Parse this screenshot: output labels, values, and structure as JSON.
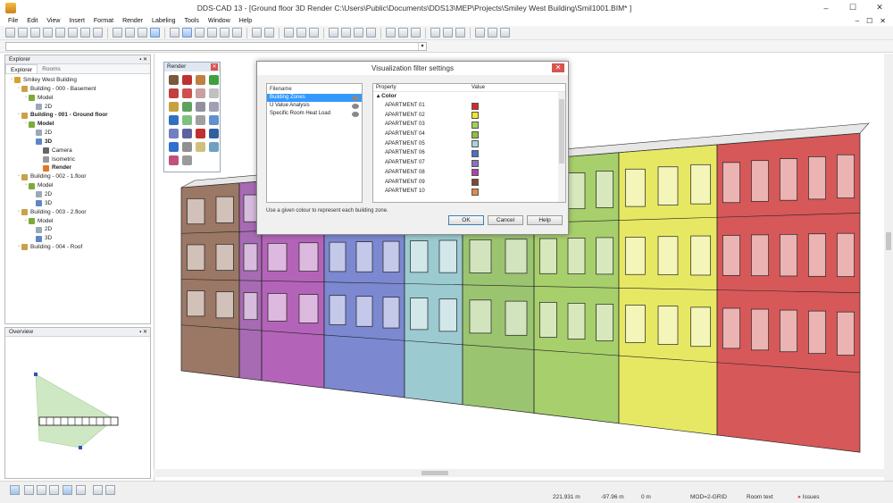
{
  "window": {
    "title": "DDS-CAD 13 - [Ground floor  3D  Render  C:\\Users\\Public\\Documents\\DDS13\\MEP\\Projects\\Smiley West Building\\Smil1001.BIM* ]",
    "minimize": "–",
    "maximize": "☐",
    "close": "✕"
  },
  "menu": [
    "File",
    "Edit",
    "View",
    "Insert",
    "Format",
    "Render",
    "Labeling",
    "Tools",
    "Window",
    "Help"
  ],
  "mdi_controls": [
    "–",
    "☐",
    "✕"
  ],
  "explorer": {
    "title": "Explorer",
    "pin": "▪ ✕",
    "tabs": [
      "Explorer",
      "Rooms"
    ],
    "tree": [
      {
        "label": "Smiley West Building",
        "level": 0,
        "icon": "project-icon",
        "bold": false
      },
      {
        "label": "Building - 000 - Basement",
        "level": 1,
        "icon": "building-icon",
        "bold": false
      },
      {
        "label": "Model",
        "level": 2,
        "icon": "model-icon",
        "bold": false
      },
      {
        "label": "2D",
        "level": 3,
        "icon": "2d-icon",
        "bold": false
      },
      {
        "label": "Building - 001 - Ground floor",
        "level": 1,
        "icon": "building-icon",
        "bold": true
      },
      {
        "label": "Model",
        "level": 2,
        "icon": "model-icon",
        "bold": true
      },
      {
        "label": "2D",
        "level": 3,
        "icon": "2d-icon",
        "bold": false
      },
      {
        "label": "3D",
        "level": 3,
        "icon": "3d-icon",
        "bold": true
      },
      {
        "label": "Camera",
        "level": 4,
        "icon": "camera-icon",
        "bold": false
      },
      {
        "label": "Isometric",
        "level": 4,
        "icon": "isometric-icon",
        "bold": false
      },
      {
        "label": "Render",
        "level": 4,
        "icon": "render-icon",
        "bold": true
      },
      {
        "label": "Building - 002 - 1.floor",
        "level": 1,
        "icon": "building-icon",
        "bold": false
      },
      {
        "label": "Model",
        "level": 2,
        "icon": "model-icon",
        "bold": false
      },
      {
        "label": "2D",
        "level": 3,
        "icon": "2d-icon",
        "bold": false
      },
      {
        "label": "3D",
        "level": 3,
        "icon": "3d-icon",
        "bold": false
      },
      {
        "label": "Building - 003 - 2.floor",
        "level": 1,
        "icon": "building-icon",
        "bold": false
      },
      {
        "label": "Model",
        "level": 2,
        "icon": "model-icon",
        "bold": false
      },
      {
        "label": "2D",
        "level": 3,
        "icon": "2d-icon",
        "bold": false
      },
      {
        "label": "3D",
        "level": 3,
        "icon": "3d-icon",
        "bold": false
      },
      {
        "label": "Building - 004 - Roof",
        "level": 1,
        "icon": "building-icon",
        "bold": false
      }
    ]
  },
  "overview": {
    "title": "Overview",
    "pin": "▪ ✕"
  },
  "render_panel": {
    "title": "Render",
    "close": "✕"
  },
  "dialog": {
    "title": "Visualization filter settings",
    "close": "✕",
    "filelist_header": "Filename",
    "files": [
      {
        "name": "Building Zones",
        "selected": true
      },
      {
        "name": "U Value Analysis",
        "selected": false
      },
      {
        "name": "Specific Room Heat Load",
        "selected": false
      }
    ],
    "prop_header": "Property",
    "value_header": "Value",
    "group": "Color",
    "properties": [
      {
        "name": "APARTMENT 01",
        "color": "#d62828"
      },
      {
        "name": "APARTMENT 02",
        "color": "#f0e62a"
      },
      {
        "name": "APARTMENT 03",
        "color": "#9fd25a"
      },
      {
        "name": "APARTMENT 04",
        "color": "#8fbf3a"
      },
      {
        "name": "APARTMENT 05",
        "color": "#a6d6d6"
      },
      {
        "name": "APARTMENT 06",
        "color": "#4f6fc4"
      },
      {
        "name": "APARTMENT 07",
        "color": "#8a72c0"
      },
      {
        "name": "APARTMENT 08",
        "color": "#b040b0"
      },
      {
        "name": "APARTMENT 09",
        "color": "#7a4a32"
      },
      {
        "name": "APARTMENT 10",
        "color": "#e08a4a"
      }
    ],
    "hint": "Use a given colour to represent each building zone.",
    "buttons": {
      "ok": "OK",
      "cancel": "Cancel",
      "help": "Help"
    }
  },
  "status": {
    "x": "221.931 m",
    "y": "-97.96 m",
    "z": "0 m",
    "mode": "MOD=2-GRID",
    "roomtext": "Room text",
    "issues": "Issues"
  }
}
